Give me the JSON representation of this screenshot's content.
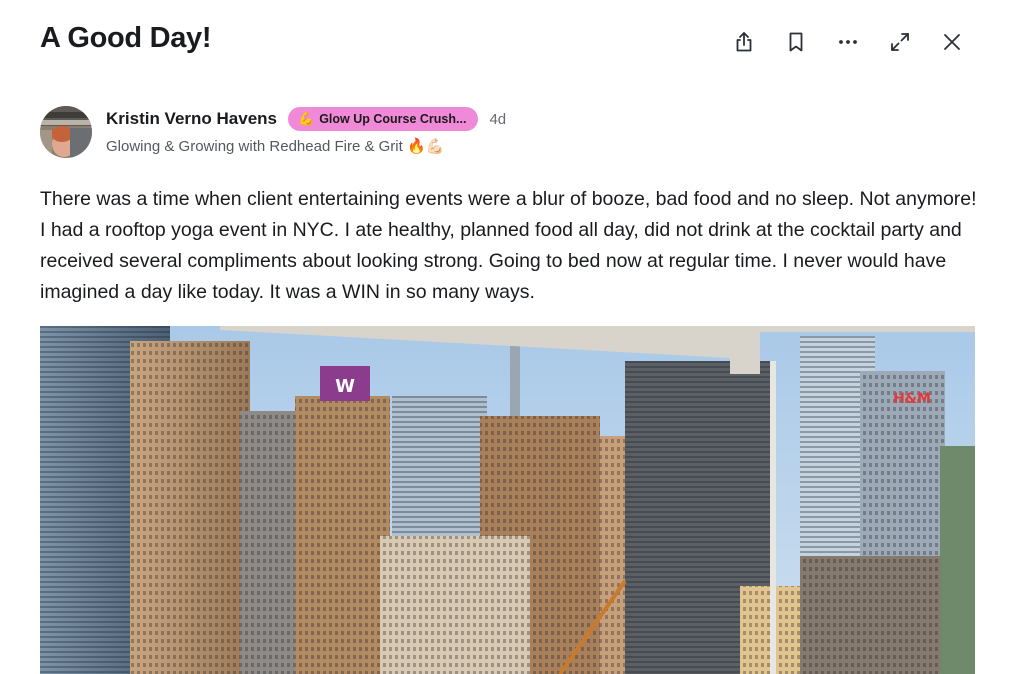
{
  "post": {
    "title": "A Good Day!",
    "author_name": "Kristin Verno Havens",
    "badge_emoji": "💪",
    "badge_label": "Glow Up Course Crush...",
    "time_ago": "4d",
    "headline": "Glowing & Growing with Redhead Fire & Grit 🔥💪🏻",
    "body": "There was a time when client entertaining events were a blur of booze, bad food and no sleep. Not anymore! I had a rooftop yoga event in NYC. I ate healthy, planned food all day, did not drink at the cocktail party and received several compliments about looking strong. Going to bed now at regular time. I never would have imagined a day like today. It was a WIN in so many ways.",
    "photo_sign_w": "W",
    "photo_sign_hm": "H&M"
  },
  "toolbar": {
    "share_icon": "share-icon",
    "bookmark_icon": "bookmark-icon",
    "more_icon": "more-horizontal-icon",
    "expand_icon": "expand-icon",
    "close_icon": "close-icon"
  },
  "colors": {
    "badge_bg": "#f08ad8",
    "text": "#191b1f",
    "muted": "#676b73"
  }
}
